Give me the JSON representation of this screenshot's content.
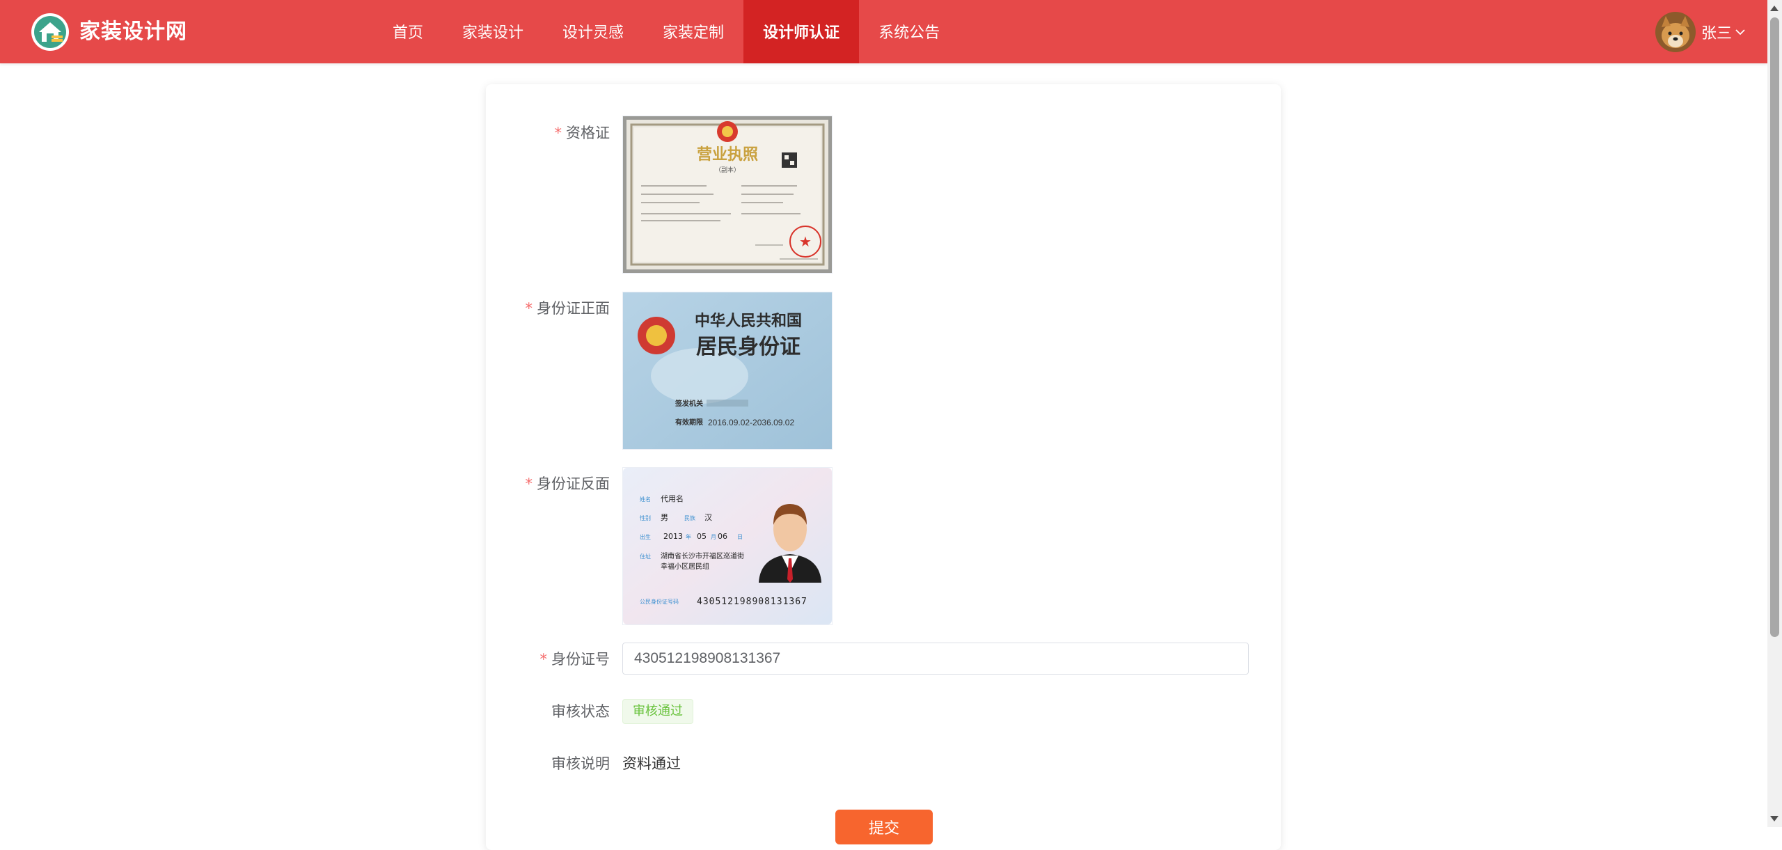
{
  "header": {
    "brand": "家装设计网",
    "nav": [
      "首页",
      "家装设计",
      "设计灵感",
      "家装定制",
      "设计师认证",
      "系统公告"
    ],
    "active_index": 4,
    "user_name": "张三",
    "colors": {
      "header_bg": "#e64949",
      "active_bg": "#d32323"
    }
  },
  "form": {
    "qualification_label": "资格证",
    "id_front_label": "身份证正面",
    "id_back_label": "身份证反面",
    "id_number_label": "身份证号",
    "id_number_value": "430512198908131367",
    "status_label": "审核状态",
    "status_value": "审核通过",
    "note_label": "审核说明",
    "note_value": "资料通过",
    "submit_label": "提交",
    "required_mark": "*"
  },
  "license_image": {
    "title": "营业执照",
    "subtitle": "（副本）"
  },
  "id_front_image": {
    "line1": "中华人民共和国",
    "line2": "居民身份证",
    "issuer_label": "签发机关",
    "validity_label": "有效期限",
    "validity_value": "2016.09.02-2036.09.02"
  },
  "id_back_image": {
    "name_label": "姓名",
    "name_value": "代用名",
    "sex_label": "性别",
    "sex_value": "男",
    "ethnic_label": "民族",
    "ethnic_value": "汉",
    "birth_label": "出生",
    "birth_year": "2013",
    "year_unit": "年",
    "birth_month": "05",
    "month_unit": "月",
    "birth_day": "06",
    "day_unit": "日",
    "address_label": "住址",
    "address_line1": "湖南省长沙市开福区巡道街",
    "address_line2": "幸福小区居民组",
    "idno_label": "公民身份证号码",
    "idno_value": "430512198908131367"
  }
}
